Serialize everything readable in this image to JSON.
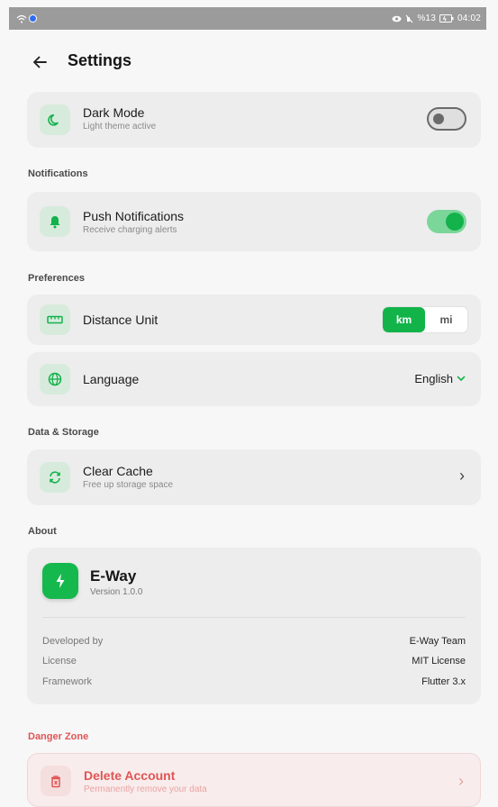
{
  "status_bar": {
    "right_text": "%13",
    "time": "04:02"
  },
  "header": {
    "title": "Settings"
  },
  "dark_mode": {
    "title": "Dark Mode",
    "subtitle": "Light theme active",
    "enabled": false
  },
  "notifications": {
    "section_label": "Notifications",
    "push": {
      "title": "Push Notifications",
      "subtitle": "Receive charging alerts",
      "enabled": true
    }
  },
  "preferences": {
    "section_label": "Preferences",
    "distance": {
      "title": "Distance Unit",
      "options": [
        "km",
        "mi"
      ],
      "selected": "km"
    },
    "language": {
      "title": "Language",
      "value": "English"
    }
  },
  "data_storage": {
    "section_label": "Data & Storage",
    "clear_cache": {
      "title": "Clear Cache",
      "subtitle": "Free up storage space"
    }
  },
  "about": {
    "section_label": "About",
    "app_name": "E-Way",
    "version": "Version 1.0.0",
    "rows": [
      {
        "label": "Developed by",
        "value": "E-Way Team"
      },
      {
        "label": "License",
        "value": "MIT License"
      },
      {
        "label": "Framework",
        "value": "Flutter 3.x"
      }
    ]
  },
  "danger_zone": {
    "section_label": "Danger Zone",
    "delete": {
      "title": "Delete Account",
      "subtitle": "Permanently remove your data"
    }
  },
  "colors": {
    "accent": "#13b24b",
    "danger": "#e05555",
    "card": "#ededed",
    "background": "#f7f7f7"
  }
}
